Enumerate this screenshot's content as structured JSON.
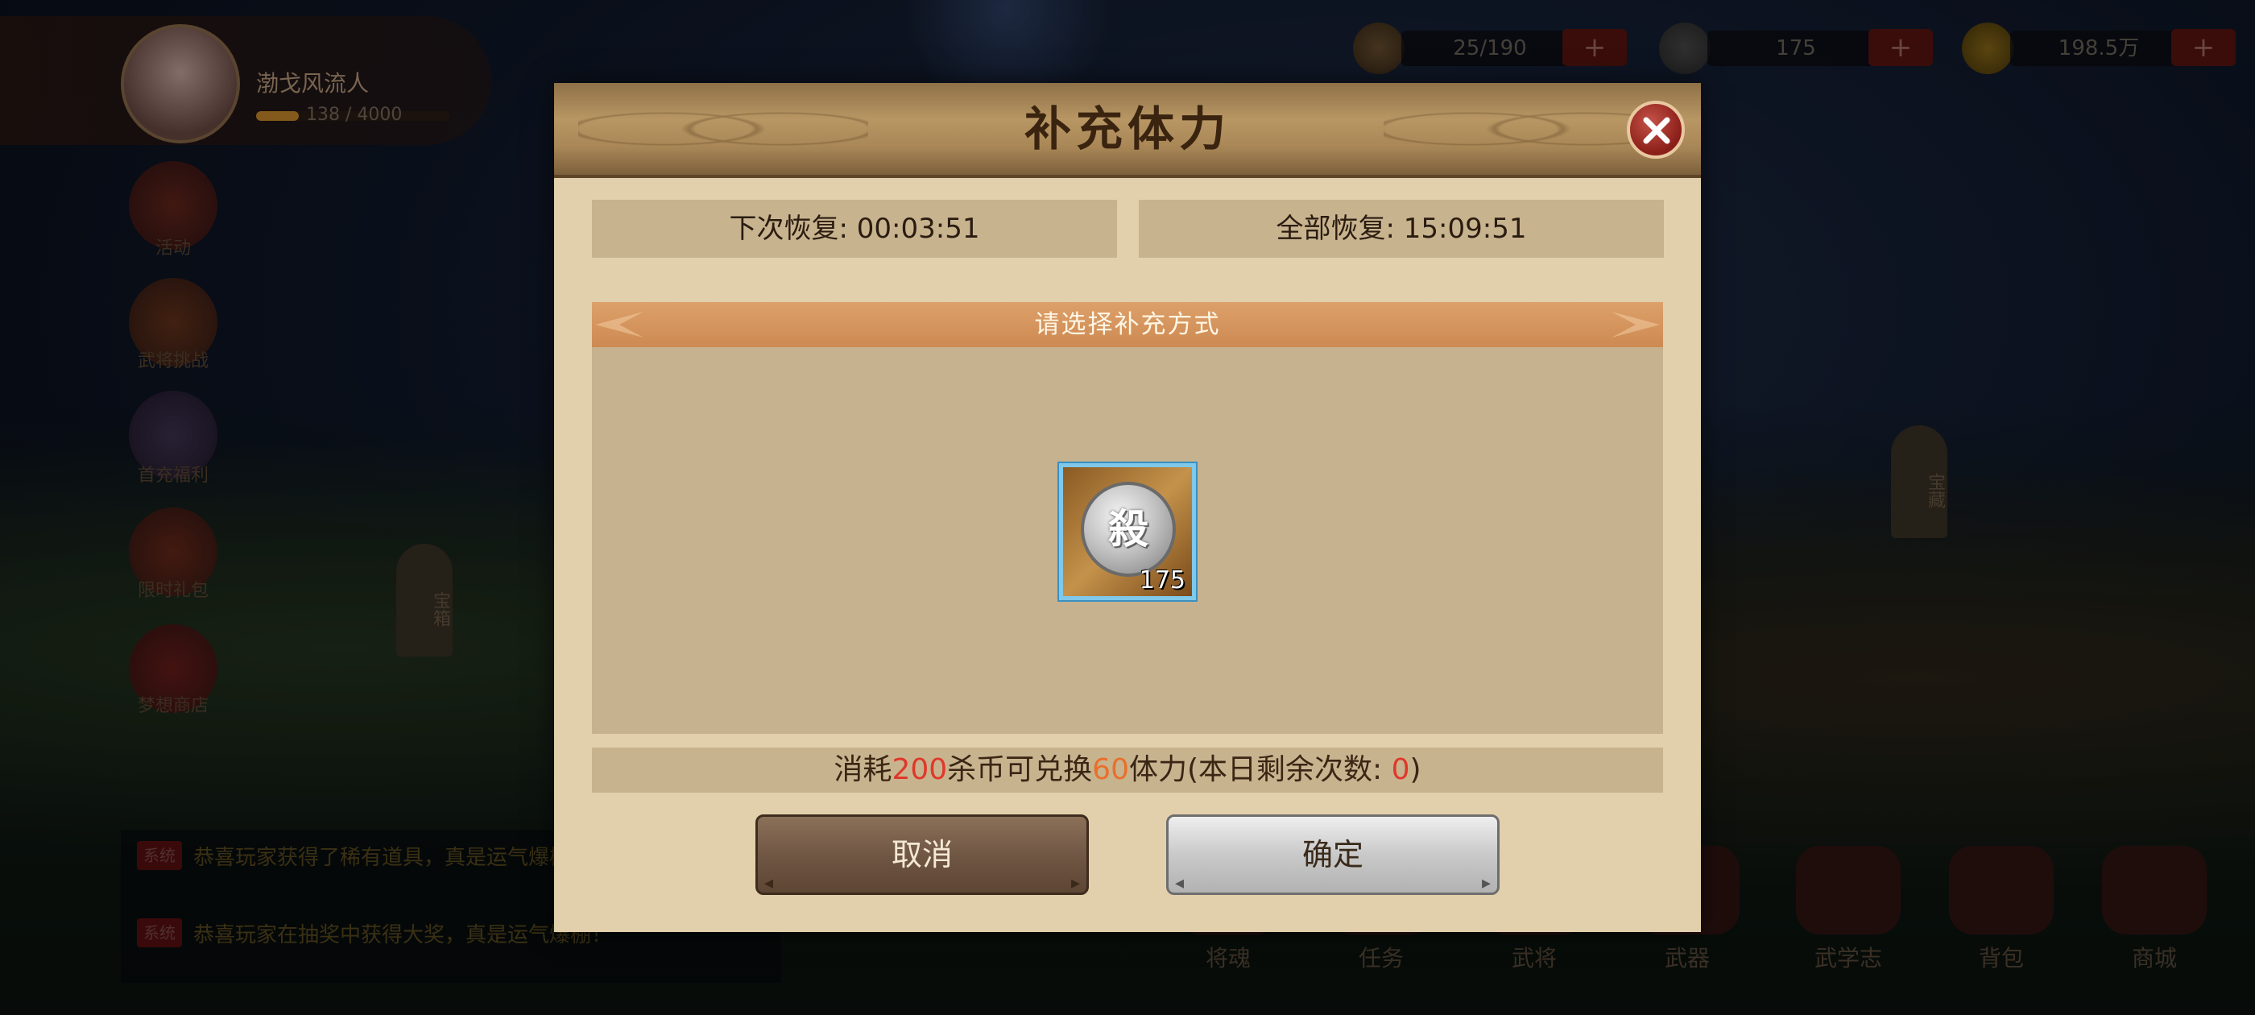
{
  "background": {
    "player": {
      "name": "渤戈风流人",
      "exp_text": "138 / 4000"
    },
    "resources": [
      {
        "icon": "stamina-icon",
        "value": "25/190",
        "plus": "+"
      },
      {
        "icon": "silver-icon",
        "value": "175",
        "plus": "+"
      },
      {
        "icon": "gold-coin-icon",
        "value": "198.5万",
        "plus": "+"
      }
    ],
    "left_menu": [
      "活动",
      "武将挑战",
      "首充福利",
      "限时礼包",
      "梦想商店"
    ],
    "steles": [
      "宝箱",
      "宝藏"
    ],
    "chat": [
      {
        "tag": "系统",
        "text": "恭喜玩家获得了稀有道具，真是运气爆棚！"
      },
      {
        "tag": "系统",
        "text": "恭喜玩家在抽奖中获得大奖，真是运气爆棚！"
      }
    ],
    "bottom_tabs": [
      "将魂",
      "任务",
      "武将",
      "武器",
      "武学志",
      "背包",
      "商城"
    ]
  },
  "dialog": {
    "title": "补充体力",
    "close_icon": "close-icon",
    "next_recover_label": "下次恢复: ",
    "next_recover_time": "00:03:51",
    "all_recover_label": "全部恢复: ",
    "all_recover_time": "15:09:51",
    "select_header": "请选择补充方式",
    "item": {
      "icon": "kill-coin-icon",
      "glyph": "殺",
      "count": "175"
    },
    "info": {
      "p1": "消耗",
      "cost": "200",
      "p2": "杀币可兑换",
      "amount": "60",
      "p3": "体力(本日剩余次数: ",
      "remaining": "0",
      "p4": ")"
    },
    "cancel_label": "取消",
    "confirm_label": "确定"
  },
  "colors": {
    "dialog_bg": "#e2d0ac",
    "panel_bg": "#c7b290",
    "header_orange": "#d4925a",
    "highlight_red": "#e0382a",
    "highlight_orange": "#e8702a",
    "slot_border": "#7fc8ea"
  }
}
